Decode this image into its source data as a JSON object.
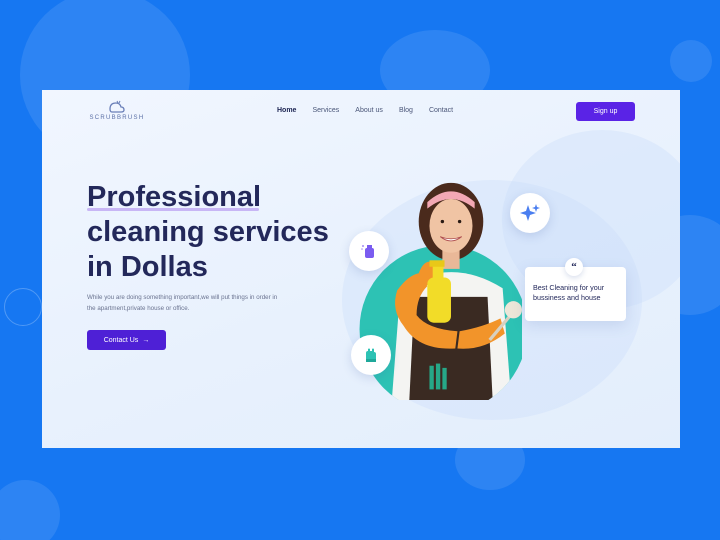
{
  "brand": {
    "name": "SCRUBBRUSH"
  },
  "nav": {
    "items": [
      {
        "label": "Home",
        "active": true
      },
      {
        "label": "Services",
        "active": false
      },
      {
        "label": "About us",
        "active": false
      },
      {
        "label": "Blog",
        "active": false
      },
      {
        "label": "Contact",
        "active": false
      }
    ],
    "signup_label": "Sign up"
  },
  "hero": {
    "line1": "Professional",
    "line2_a": "cleaning ",
    "line2_b": "services",
    "line3_a": "in ",
    "line3_b": "Dollas",
    "subtitle": "While you are doing something important,we will put things in order in the apartment,private house or office.",
    "cta_label": "Contact Us",
    "cta_arrow": "→"
  },
  "card": {
    "quote_mark": "“",
    "text": "Best Cleaning for your bussiness and house"
  },
  "icons": [
    "sparkles-icon",
    "spray-bottle-icon",
    "glove-icon",
    "quote-icon",
    "arrow-right-icon"
  ],
  "colors": {
    "page_bg": "#1677f2",
    "primary": "#5a23e6",
    "heading": "#23285a",
    "teal": "#2dc2b4"
  }
}
